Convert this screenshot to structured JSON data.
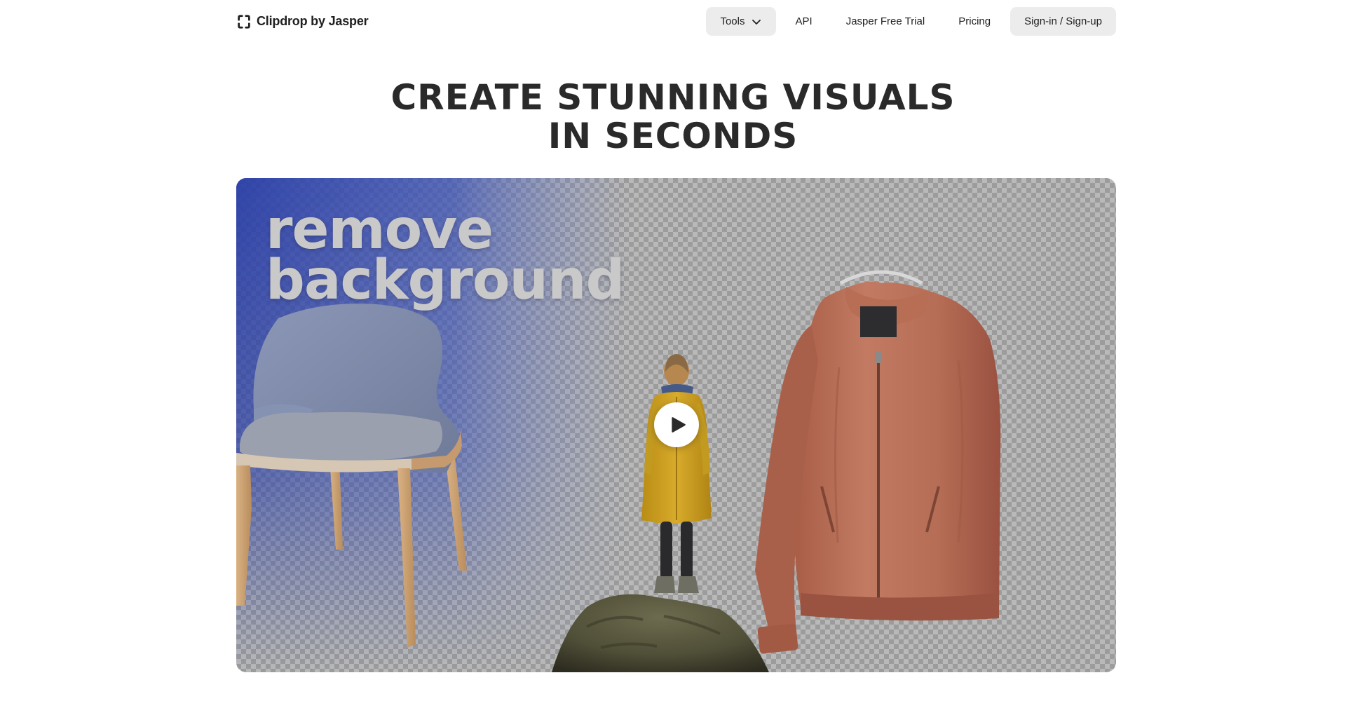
{
  "header": {
    "brand": {
      "name": "Clipdrop by Jasper",
      "icon": "clipdrop-logo-icon"
    },
    "nav": {
      "tools": "Tools",
      "api": "API",
      "free_trial": "Jasper Free Trial",
      "pricing": "Pricing",
      "signin": "Sign-in / Sign-up"
    }
  },
  "hero": {
    "title_line1": "CREATE STUNNING VISUALS",
    "title_line2": "IN SECONDS"
  },
  "video": {
    "overlay_line1": "remove",
    "overlay_line2": "background",
    "play_icon": "play-icon",
    "colors": {
      "blue_wash": "#2b3fa8",
      "checker_light": "#b9b9b9",
      "checker_dark": "#9c9c9c",
      "raincoat": "#d1a526",
      "jacket": "#b76d55"
    }
  }
}
